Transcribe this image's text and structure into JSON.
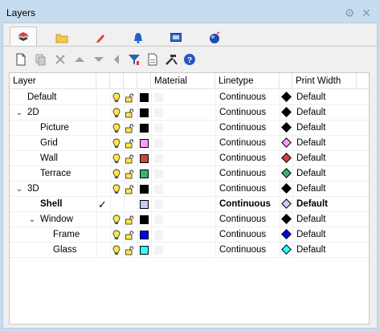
{
  "window": {
    "title": "Layers"
  },
  "tabs": [
    {
      "icon": "layers-tab-icon",
      "active": true
    },
    {
      "icon": "folder-tab-icon",
      "active": false
    },
    {
      "icon": "brush-tab-icon",
      "active": false
    },
    {
      "icon": "bell-tab-icon",
      "active": false
    },
    {
      "icon": "display-tab-icon",
      "active": false
    },
    {
      "icon": "sphere-tab-icon",
      "active": false
    }
  ],
  "toolbar": [
    "new-layer-icon",
    "new-sublayer-icon",
    "delete-icon",
    "move-up-icon",
    "move-down-icon",
    "move-to-parent-icon",
    "filter-icon",
    "copy-icon",
    "tools-icon",
    "help-icon"
  ],
  "columns": {
    "layer": "Layer",
    "material": "Material",
    "linetype": "Linetype",
    "print_width": "Print Width"
  },
  "rows": [
    {
      "name": "Default",
      "depth": 0,
      "expander": "",
      "color": "#000000",
      "linetype": "Continuous",
      "print_width": "Default",
      "print_color": "#000000",
      "current": false,
      "bold": false
    },
    {
      "name": "2D",
      "depth": 0,
      "expander": "⌄",
      "color": "#000000",
      "linetype": "Continuous",
      "print_width": "Default",
      "print_color": "#000000",
      "current": false,
      "bold": false
    },
    {
      "name": "Picture",
      "depth": 1,
      "expander": "",
      "color": "#000000",
      "linetype": "Continuous",
      "print_width": "Default",
      "print_color": "#000000",
      "current": false,
      "bold": false
    },
    {
      "name": "Grid",
      "depth": 1,
      "expander": "",
      "color": "#ff9cff",
      "linetype": "Continuous",
      "print_width": "Default",
      "print_color": "#ff9cff",
      "current": false,
      "bold": false
    },
    {
      "name": "Wall",
      "depth": 1,
      "expander": "",
      "color": "#cc4444",
      "linetype": "Continuous",
      "print_width": "Default",
      "print_color": "#cc4444",
      "current": false,
      "bold": false
    },
    {
      "name": "Terrace",
      "depth": 1,
      "expander": "",
      "color": "#3cb36b",
      "linetype": "Continuous",
      "print_width": "Default",
      "print_color": "#3cb36b",
      "current": false,
      "bold": false
    },
    {
      "name": "3D",
      "depth": 0,
      "expander": "⌄",
      "color": "#000000",
      "linetype": "Continuous",
      "print_width": "Default",
      "print_color": "#000000",
      "current": false,
      "bold": false
    },
    {
      "name": "Shell",
      "depth": 1,
      "expander": "",
      "color": "#c8c8ff",
      "linetype": "Continuous",
      "print_width": "Default",
      "print_color": "#c8c8ff",
      "current": true,
      "bold": true
    },
    {
      "name": "Window",
      "depth": 1,
      "expander": "⌄",
      "color": "#000000",
      "linetype": "Continuous",
      "print_width": "Default",
      "print_color": "#000000",
      "current": false,
      "bold": false
    },
    {
      "name": "Frame",
      "depth": 2,
      "expander": "",
      "color": "#0000ee",
      "linetype": "Continuous",
      "print_width": "Default",
      "print_color": "#0000ee",
      "current": false,
      "bold": false
    },
    {
      "name": "Glass",
      "depth": 2,
      "expander": "",
      "color": "#33ffff",
      "linetype": "Continuous",
      "print_width": "Default",
      "print_color": "#33ffff",
      "current": false,
      "bold": false
    }
  ],
  "current_marker": "✓"
}
